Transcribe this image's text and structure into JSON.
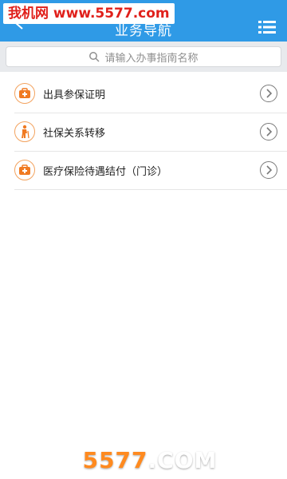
{
  "header": {
    "title": "业务导航",
    "watermark": "我机网 www.5577.com"
  },
  "search": {
    "placeholder": "请输入办事指南名称"
  },
  "items": [
    {
      "label": "出具参保证明",
      "icon": "medical-kit-icon"
    },
    {
      "label": "社保关系转移",
      "icon": "elderly-person-icon"
    },
    {
      "label": "医疗保险待遇结付（门诊）",
      "icon": "medical-kit-icon"
    }
  ],
  "footer": {
    "watermark_part1": "5577",
    "watermark_part2": ".COM"
  },
  "colors": {
    "header_bg": "#2f9ae6",
    "icon_accent": "#f07a22"
  }
}
